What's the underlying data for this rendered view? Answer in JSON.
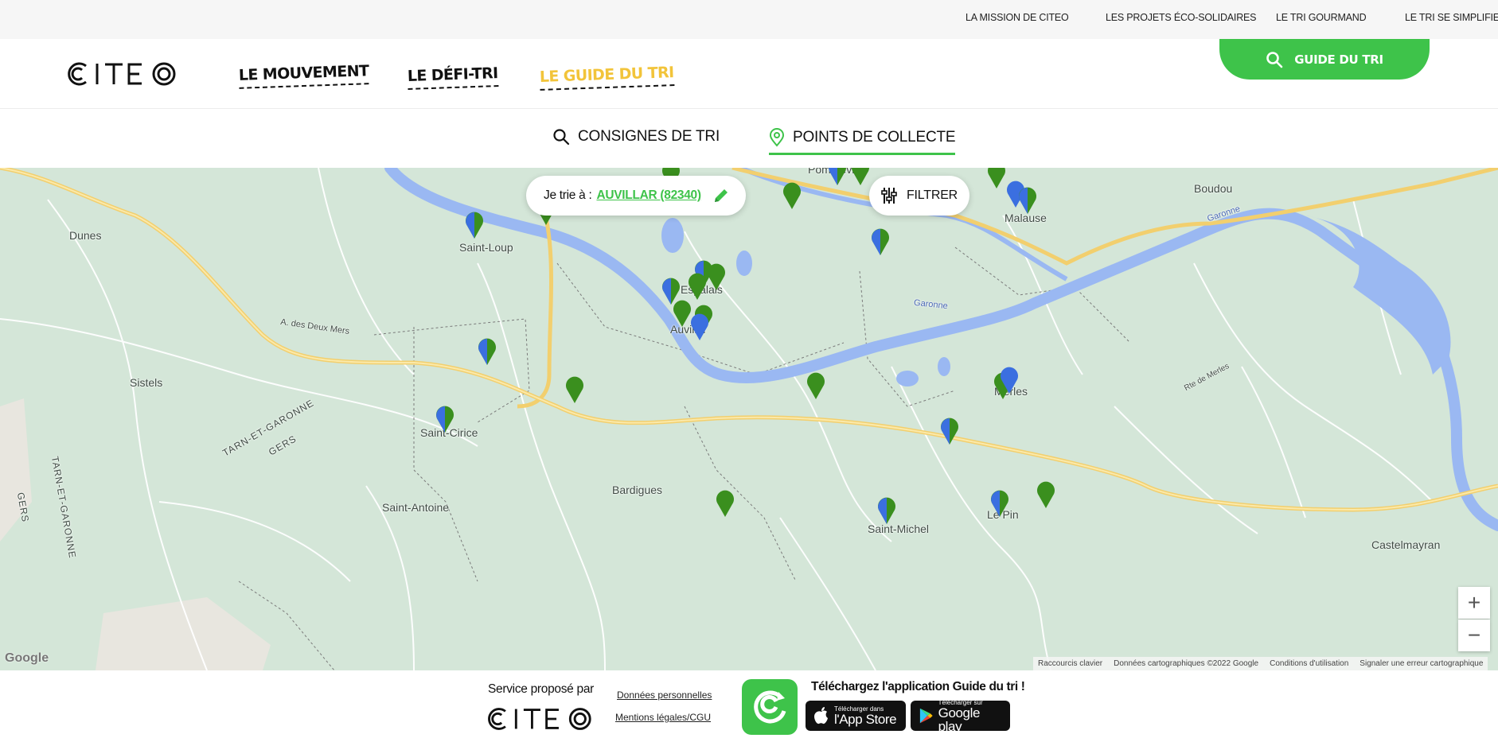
{
  "utility_nav": {
    "items": [
      "LA MISSION DE CITEO",
      "LES PROJETS ÉCO-SOLIDAIRES",
      "LE TRI GOURMAND",
      "LE TRI SE SIMPLIFIE"
    ]
  },
  "header": {
    "logo_text": "CITEO",
    "menu": [
      "LE MOUVEMENT",
      "LE DÉFI-TRI",
      "LE GUIDE DU TRI"
    ],
    "guide_button": "GUIDE DU TRI"
  },
  "tabs": [
    {
      "label": "CONSIGNES DE TRI",
      "icon": "search-icon",
      "active": false
    },
    {
      "label": "POINTS DE COLLECTE",
      "icon": "location-pin-icon",
      "active": true
    }
  ],
  "map": {
    "town_prefix": "Je trie à :",
    "town_value": "AUVILLAR (82340)",
    "filter_label": "FILTRER",
    "zoom_in": "+",
    "zoom_out": "−",
    "places": {
      "pommevic": "Pommevic",
      "boudou": "Boudou",
      "malause": "Malause",
      "dunes": "Dunes",
      "saint_loup": "Saint-Loup",
      "espalais": "Espalais",
      "auvillar": "Auvillar",
      "sistels": "Sistels",
      "saint_cirice": "Saint-Cirice",
      "merles": "Merles",
      "bardigues": "Bardigues",
      "saint_antoine": "Saint-Antoine",
      "saint_michel": "Saint-Michel",
      "le_pin": "Le Pin",
      "castelmayran": "Castelmayran",
      "tarn_et_garonne": "TARN-ET-GARONNE",
      "gers": "GERS",
      "tarn_et_garonne_vertical": "TARN-ET-GARONNE",
      "gers_vertical": "GERS",
      "autoroute": "A. des Deux Mers",
      "garonne_1": "Garonne",
      "garonne_2": "Garonne",
      "rte_de_merles": "Rte de Merles"
    },
    "attribution": [
      "Raccourcis clavier",
      "Données cartographiques ©2022 Google",
      "Conditions d'utilisation",
      "Signaler une erreur cartographique"
    ],
    "google_logo": "Google",
    "pin_colors": {
      "green": "#3a8f1e",
      "blue": "#3b6fe0"
    }
  },
  "footer": {
    "service_label": "Service proposé par",
    "logo_text": "CITEO",
    "links": [
      "Données personnelles",
      "Mentions légales/CGU"
    ],
    "app_title": "Téléchargez l'application Guide du tri !",
    "app_store": {
      "small": "Télécharger dans",
      "big": "l'App Store"
    },
    "google_play": {
      "small": "Télécharger sur",
      "big": "Google play"
    }
  }
}
